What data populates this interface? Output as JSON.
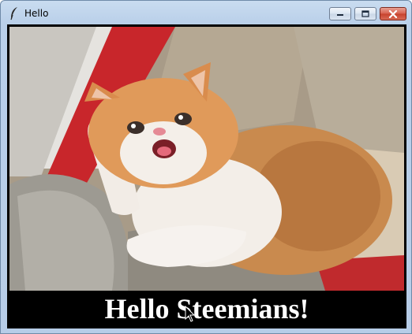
{
  "window": {
    "title": "Hello",
    "app_icon": "feather-icon",
    "controls": [
      "minimize-icon",
      "maximize-icon",
      "close-icon"
    ]
  },
  "content": {
    "image": "kitten-photo",
    "caption": "Hello Steemians!"
  },
  "cursor": "mouse-pointer-icon",
  "colors": {
    "caption_bg": "#000000",
    "caption_text": "#ffffff",
    "close_button": "#c7412c"
  }
}
